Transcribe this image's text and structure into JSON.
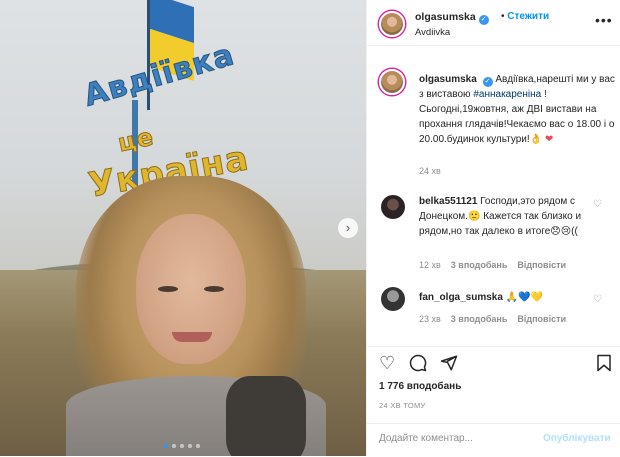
{
  "post": {
    "author": "olgasumska",
    "follow_label": "Стежити",
    "location": "Avdiivka",
    "more_icon": "more-horizontal-icon",
    "verified_icon": "verified-badge-icon"
  },
  "photo": {
    "sign_line1": "Авдіївка",
    "sign_line2": "це",
    "sign_line3": "Україна",
    "carousel_pages": 5,
    "carousel_active": 1,
    "next_icon": "chevron-right-icon"
  },
  "caption": {
    "author": "olgasumska",
    "text_before": "Авдіївка,нарешті ми у вас з виставою ",
    "hashtag": "#аннакареніна",
    "text_after": " ! Сьогодні,19жовтня, аж ДВІ вистави на прохання глядачів!Чекаємо вас о 18.00 і о 20.00.будинок культури!👌",
    "emoji": "❤",
    "time": "24 хв"
  },
  "comments": [
    {
      "author": "belka551121",
      "text": "Господи,это рядом с Донецком.🙂 Кажется так близко и рядом,но так далеко в итоге😞😢((",
      "time": "12 хв",
      "likes": "3 вподобань",
      "reply": "Відповісти"
    },
    {
      "author": "fan_olga_sumska",
      "text": "🙏💙💛",
      "time": "23 хв",
      "likes": "3 вподобань",
      "reply": "Відповісти"
    }
  ],
  "actions": {
    "like_icon": "heart-icon",
    "comment_icon": "comment-icon",
    "share_icon": "share-icon",
    "save_icon": "bookmark-icon",
    "likes_count": "1 776 вподобань",
    "posted_ago": "24 ХВ ТОМУ"
  },
  "composer": {
    "placeholder": "Додайте коментар...",
    "value": "",
    "publish_label": "Опублікувати"
  },
  "colors": {
    "accent": "#0095f6",
    "publish_disabled": "#b2dffc",
    "muted": "#8e8e8e",
    "text": "#262626"
  }
}
